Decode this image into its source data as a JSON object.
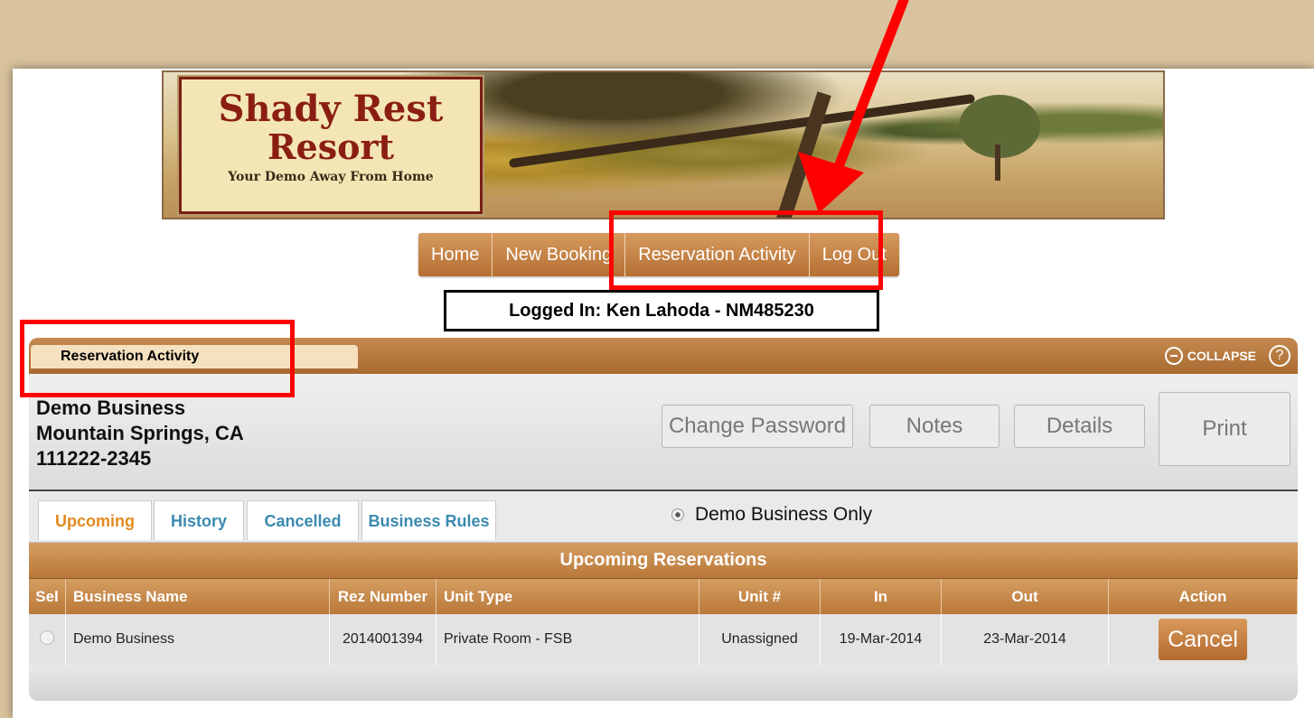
{
  "banner": {
    "title_line1": "Shady Rest",
    "title_line2": "Resort",
    "tagline": "Your Demo Away From Home"
  },
  "nav": {
    "items": [
      "Home",
      "New Booking",
      "Reservation Activity",
      "Log Out"
    ]
  },
  "login": {
    "text": "Logged In: Ken Lahoda - NM485230"
  },
  "panel": {
    "tab_label": "Reservation Activity",
    "collapse_label": "COLLAPSE",
    "help_label": "?",
    "business": {
      "name": "Demo Business",
      "location": "Mountain Springs, CA",
      "phone": "111222-2345"
    },
    "buttons": {
      "change_password": "Change Password",
      "notes": "Notes",
      "details": "Details",
      "print": "Print"
    },
    "tabs": [
      "Upcoming",
      "History",
      "Cancelled",
      "Business Rules"
    ],
    "filter_option": "Demo Business Only",
    "table_title": "Upcoming Reservations",
    "columns": [
      "Sel",
      "Business Name",
      "Rez Number",
      "Unit Type",
      "Unit #",
      "In",
      "Out",
      "Action"
    ],
    "rows": [
      {
        "business_name": "Demo Business",
        "rez_number": "2014001394",
        "unit_type": "Private Room - FSB",
        "unit_no": "Unassigned",
        "in": "19-Mar-2014",
        "out": "23-Mar-2014",
        "action": "Cancel"
      }
    ]
  },
  "colors": {
    "background": "#d9c39e",
    "nav_brown": "#b56f33",
    "tab_orange": "#e38a1e",
    "tab_blue": "#3a8ab0",
    "annotation_red": "#ff0000"
  }
}
